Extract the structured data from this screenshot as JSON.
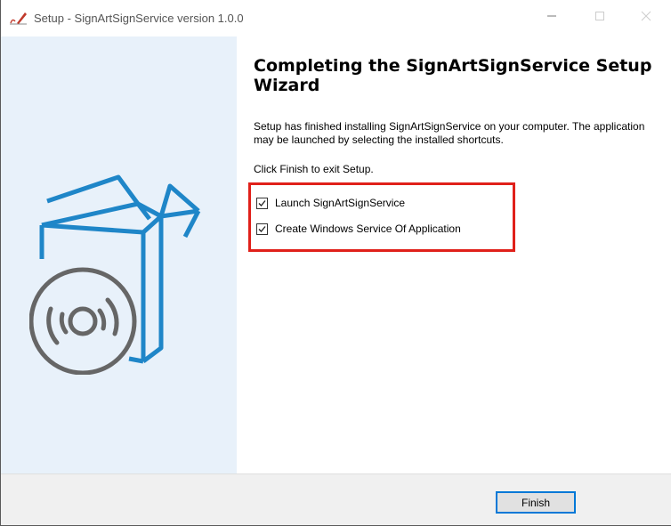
{
  "window": {
    "title": "Setup - SignArtSignService version 1.0.0"
  },
  "icons": {
    "app": "setup-signature-icon",
    "minimize": "minimize-icon",
    "maximize": "maximize-icon",
    "close": "close-icon",
    "banner": "box-with-disc-icon"
  },
  "content": {
    "heading": "Completing the SignArtSignService Setup Wizard",
    "description": "Setup has finished installing SignArtSignService on your computer. The application may be launched by selecting the installed shortcuts.",
    "exit_instruction": "Click Finish to exit Setup.",
    "options": [
      {
        "label": "Launch SignArtSignService",
        "checked": true
      },
      {
        "label": "Create Windows Service Of Application",
        "checked": true
      }
    ]
  },
  "footer": {
    "finish_label": "Finish"
  },
  "colors": {
    "banner_bg": "#e8f1fa",
    "accent_blue": "#1f86c8",
    "highlight_red": "#e0201a",
    "button_focus": "#0078d7"
  }
}
